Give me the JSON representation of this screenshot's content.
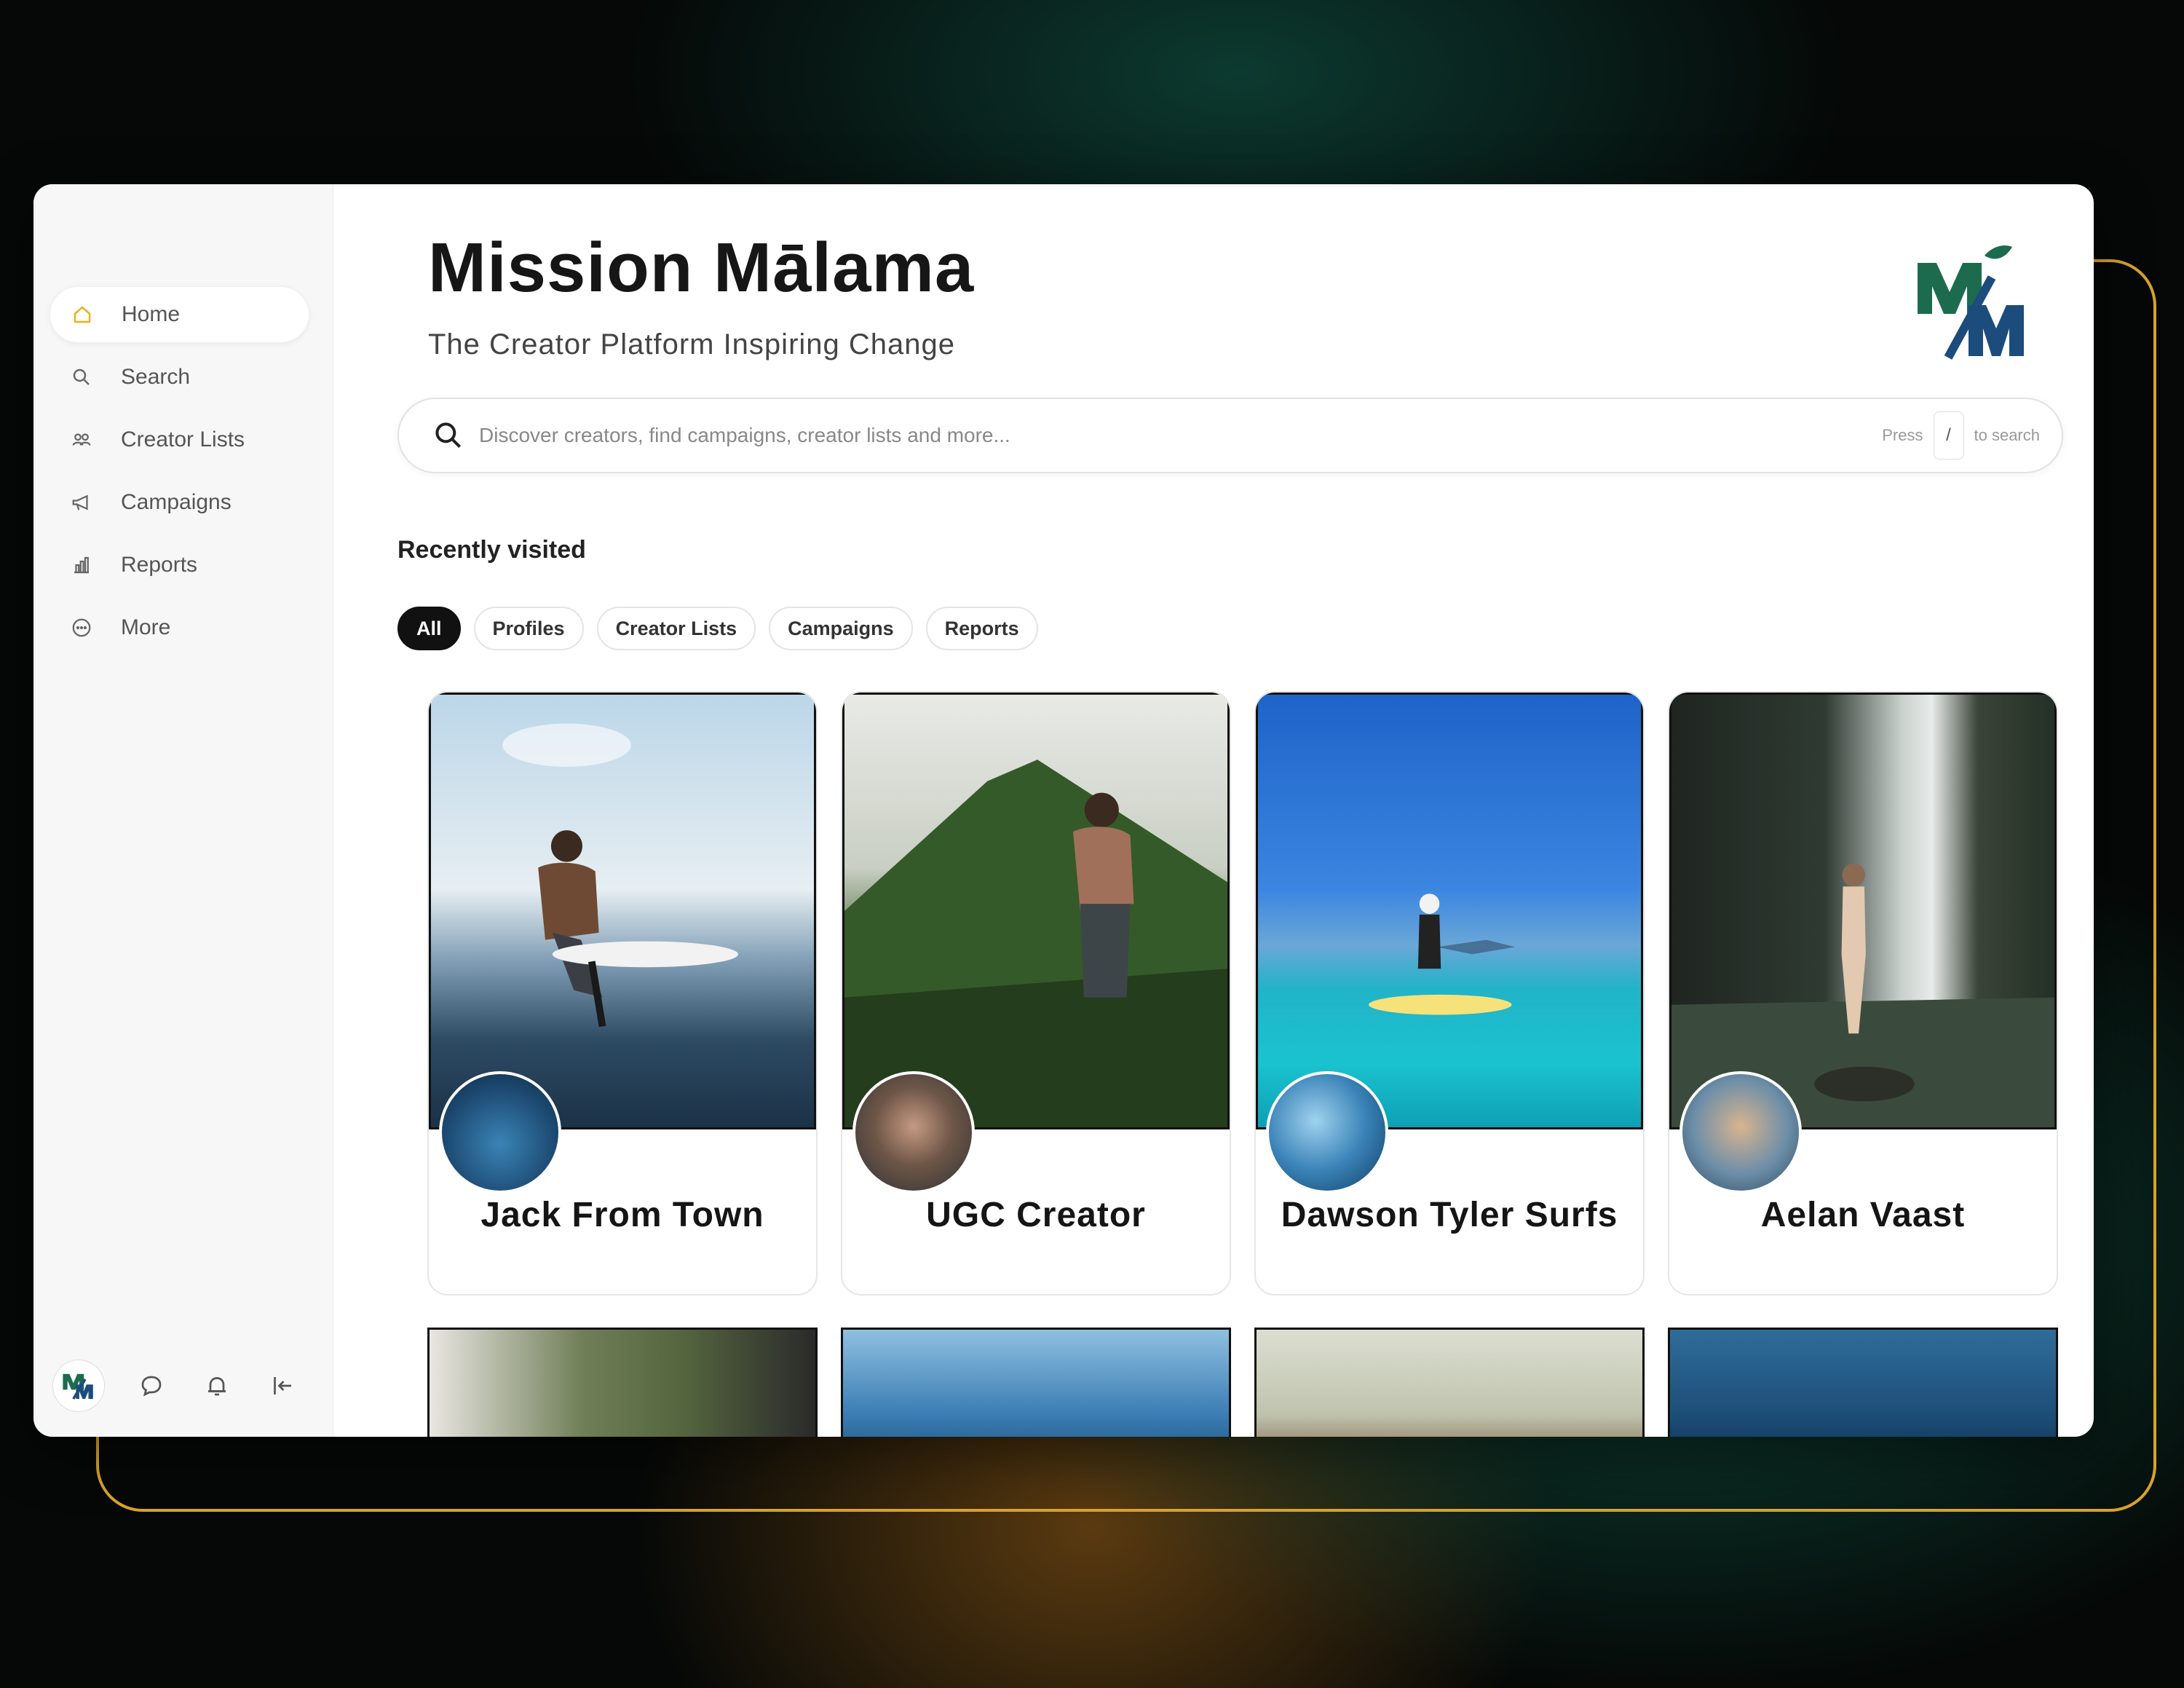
{
  "app": {
    "title": "Mission Mālama",
    "subtitle": "The Creator Platform Inspiring Change"
  },
  "sidebar": {
    "items": [
      {
        "label": "Home",
        "icon": "home-icon",
        "active": true
      },
      {
        "label": "Search",
        "icon": "search-icon",
        "active": false
      },
      {
        "label": "Creator Lists",
        "icon": "users-icon",
        "active": false
      },
      {
        "label": "Campaigns",
        "icon": "megaphone-icon",
        "active": false
      },
      {
        "label": "Reports",
        "icon": "bar-chart-icon",
        "active": false
      },
      {
        "label": "More",
        "icon": "more-icon",
        "active": false
      }
    ],
    "footer_icons": [
      "chat-icon",
      "bell-icon",
      "collapse-icon"
    ]
  },
  "search": {
    "placeholder": "Discover creators, find campaigns, creator lists and more...",
    "hint_press": "Press",
    "hint_key": "/",
    "hint_suffix": "to search"
  },
  "recent": {
    "title": "Recently visited",
    "filters": [
      "All",
      "Profiles",
      "Creator Lists",
      "Campaigns",
      "Reports"
    ],
    "active_filter": "All",
    "cards": [
      {
        "name": "Jack From Town"
      },
      {
        "name": "UGC Creator"
      },
      {
        "name": "Dawson Tyler Surfs"
      },
      {
        "name": "Aelan Vaast"
      }
    ]
  },
  "colors": {
    "accent_outline": "#d9a32a",
    "brand_green": "#1d6b4f",
    "brand_blue": "#1c4c7c",
    "active_home_icon": "#e8b21e"
  }
}
